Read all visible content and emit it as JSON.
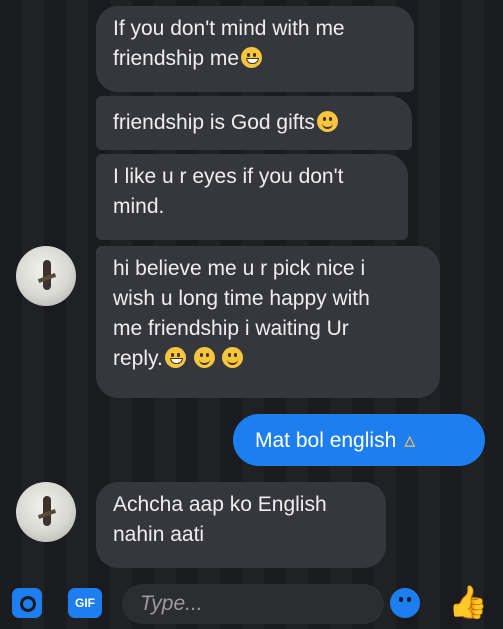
{
  "messages": [
    {
      "text": "If you don't mind with me\nfriendship me",
      "emoji": [
        "grin"
      ]
    },
    {
      "text": "friendship is God gifts",
      "emoji": [
        "smile"
      ]
    },
    {
      "text": "I like u r eyes if you don't\nmind.",
      "emoji": []
    },
    {
      "text": "hi believe me u r  pick nice i\nwish u long time happy with\nme friendship i waiting Ur\nreply.",
      "emoji": [
        "grin",
        "smile",
        "wink"
      ]
    },
    {
      "text": "Mat bol english",
      "emoji": [
        "folded-hands"
      ],
      "sent": true
    },
    {
      "text": "Achcha aap ko English\nnahin aati",
      "emoji": []
    }
  ],
  "composer": {
    "placeholder": "Type...",
    "gif_label": "GIF",
    "icons": [
      "camera-icon",
      "gif-icon",
      "emoji-icon",
      "like-icon"
    ]
  },
  "colors": {
    "sent_bubble": "#1d7ef0",
    "received_bubble": "#36373c",
    "background": "#1a1b1e"
  }
}
